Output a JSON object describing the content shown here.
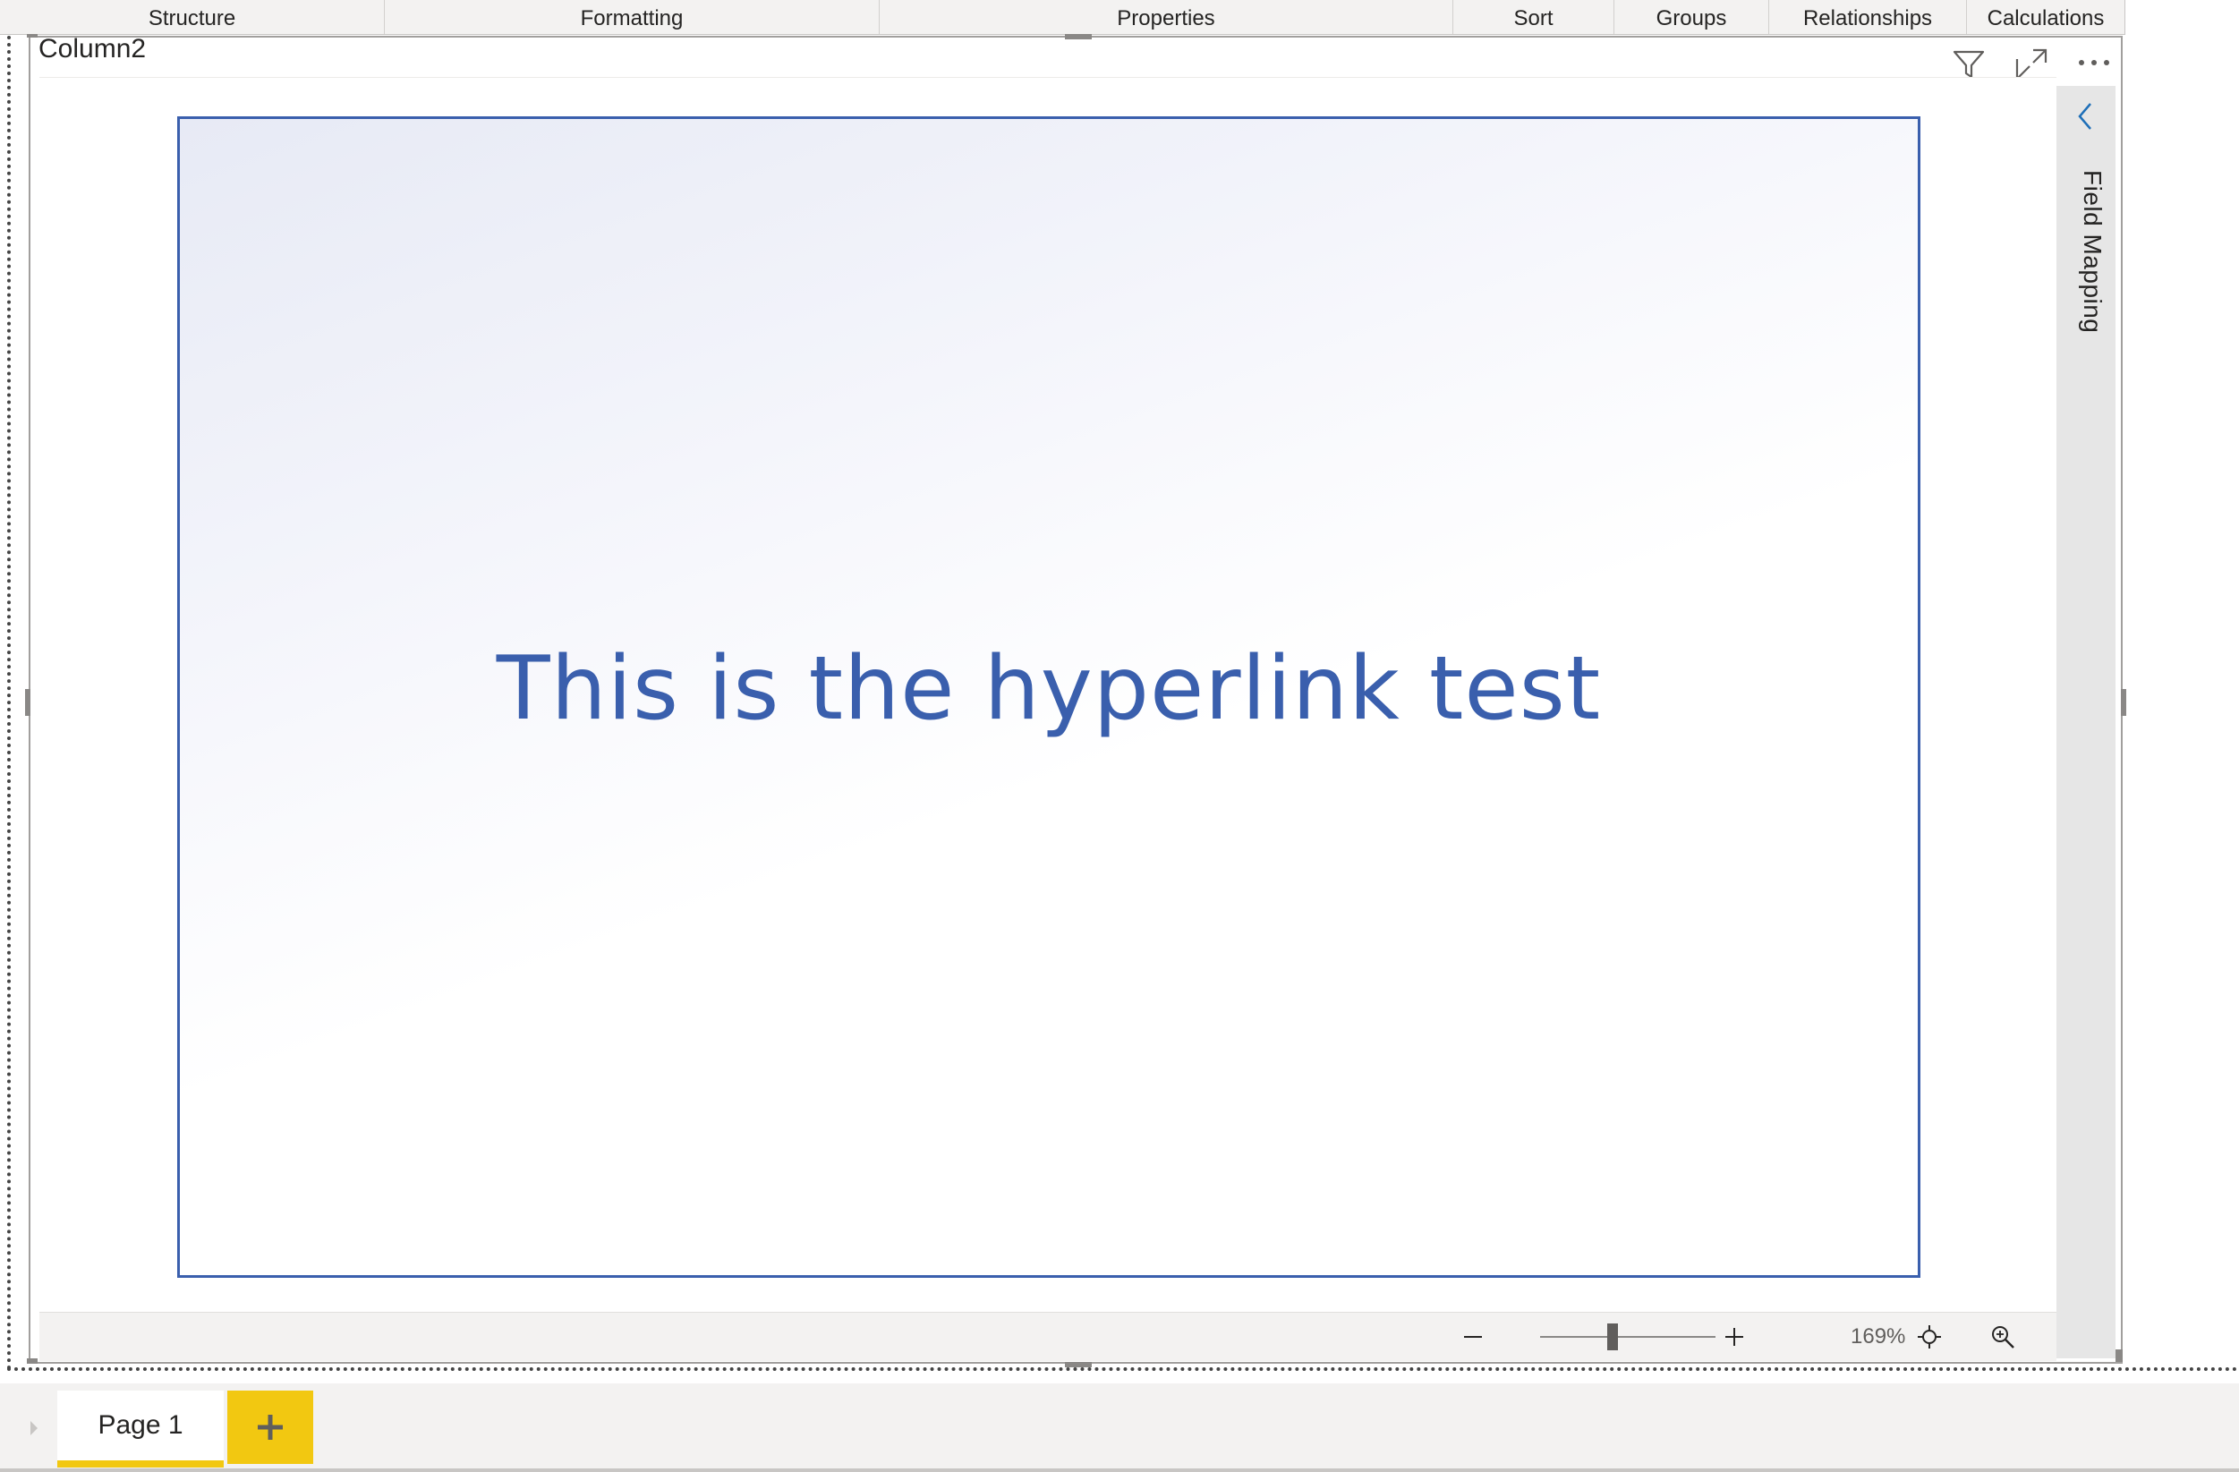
{
  "ribbon": {
    "groups": [
      {
        "label": "Structure"
      },
      {
        "label": "Formatting"
      },
      {
        "label": "Properties"
      },
      {
        "label": "Sort"
      },
      {
        "label": "Groups"
      },
      {
        "label": "Relationships"
      },
      {
        "label": "Calculations"
      }
    ]
  },
  "visual": {
    "title": "Column2",
    "header_icons": [
      "filter-icon",
      "focus-mode-icon",
      "more-options-icon"
    ],
    "hyperlink_text": "This is the hyperlink test",
    "colors": {
      "link": "#3a5fad",
      "gradient_start": "#e7eaf5",
      "pane": "#e6e6e6"
    }
  },
  "side_pane": {
    "label": "Field Mapping",
    "collapse_icon": "chevron-left-icon"
  },
  "zoom": {
    "minus_icon": "minus-icon",
    "plus_icon": "plus-icon",
    "level": "169%",
    "level_value": 169,
    "fit_icon": "fit-to-page-icon",
    "zoom_icon": "zoom-magnifier-icon"
  },
  "page_tabs": {
    "pages": [
      {
        "label": "Page 1",
        "active": true
      }
    ],
    "add_icon": "plus-icon",
    "accent": "#f2c811"
  }
}
